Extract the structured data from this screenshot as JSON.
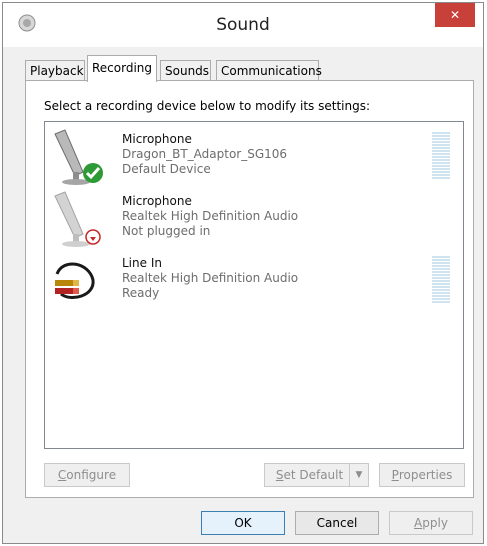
{
  "window": {
    "title": "Sound",
    "close_symbol": "✕"
  },
  "tabs": [
    {
      "label": "Playback",
      "active": false
    },
    {
      "label": "Recording",
      "active": true
    },
    {
      "label": "Sounds",
      "active": false
    },
    {
      "label": "Communications",
      "active": false
    }
  ],
  "panel": {
    "instruction": "Select a recording device below to modify its settings:",
    "devices": [
      {
        "name": "Microphone",
        "driver": "Dragon_BT_Adaptor_SG106",
        "status": "Default Device",
        "icon": "microphone-icon",
        "badge": "default-check",
        "level_meter": true
      },
      {
        "name": "Microphone",
        "driver": "Realtek High Definition Audio",
        "status": "Not plugged in",
        "icon": "microphone-icon",
        "badge": "unplugged",
        "level_meter": false
      },
      {
        "name": "Line In",
        "driver": "Realtek High Definition Audio",
        "status": "Ready",
        "icon": "line-in-cable-icon",
        "badge": "none",
        "level_meter": true
      }
    ],
    "configure_label_u": "C",
    "configure_label_rest": "onfigure",
    "set_default_label_u": "S",
    "set_default_label_rest": "et Default",
    "properties_label_u": "P",
    "properties_label_rest": "roperties"
  },
  "footer": {
    "ok_label": "OK",
    "cancel_label": "Cancel",
    "apply_label_u": "A",
    "apply_label_rest": "pply"
  },
  "colors": {
    "close_red": "#c7413a",
    "check_green": "#2e9a35",
    "unplug_red": "#c62828"
  }
}
